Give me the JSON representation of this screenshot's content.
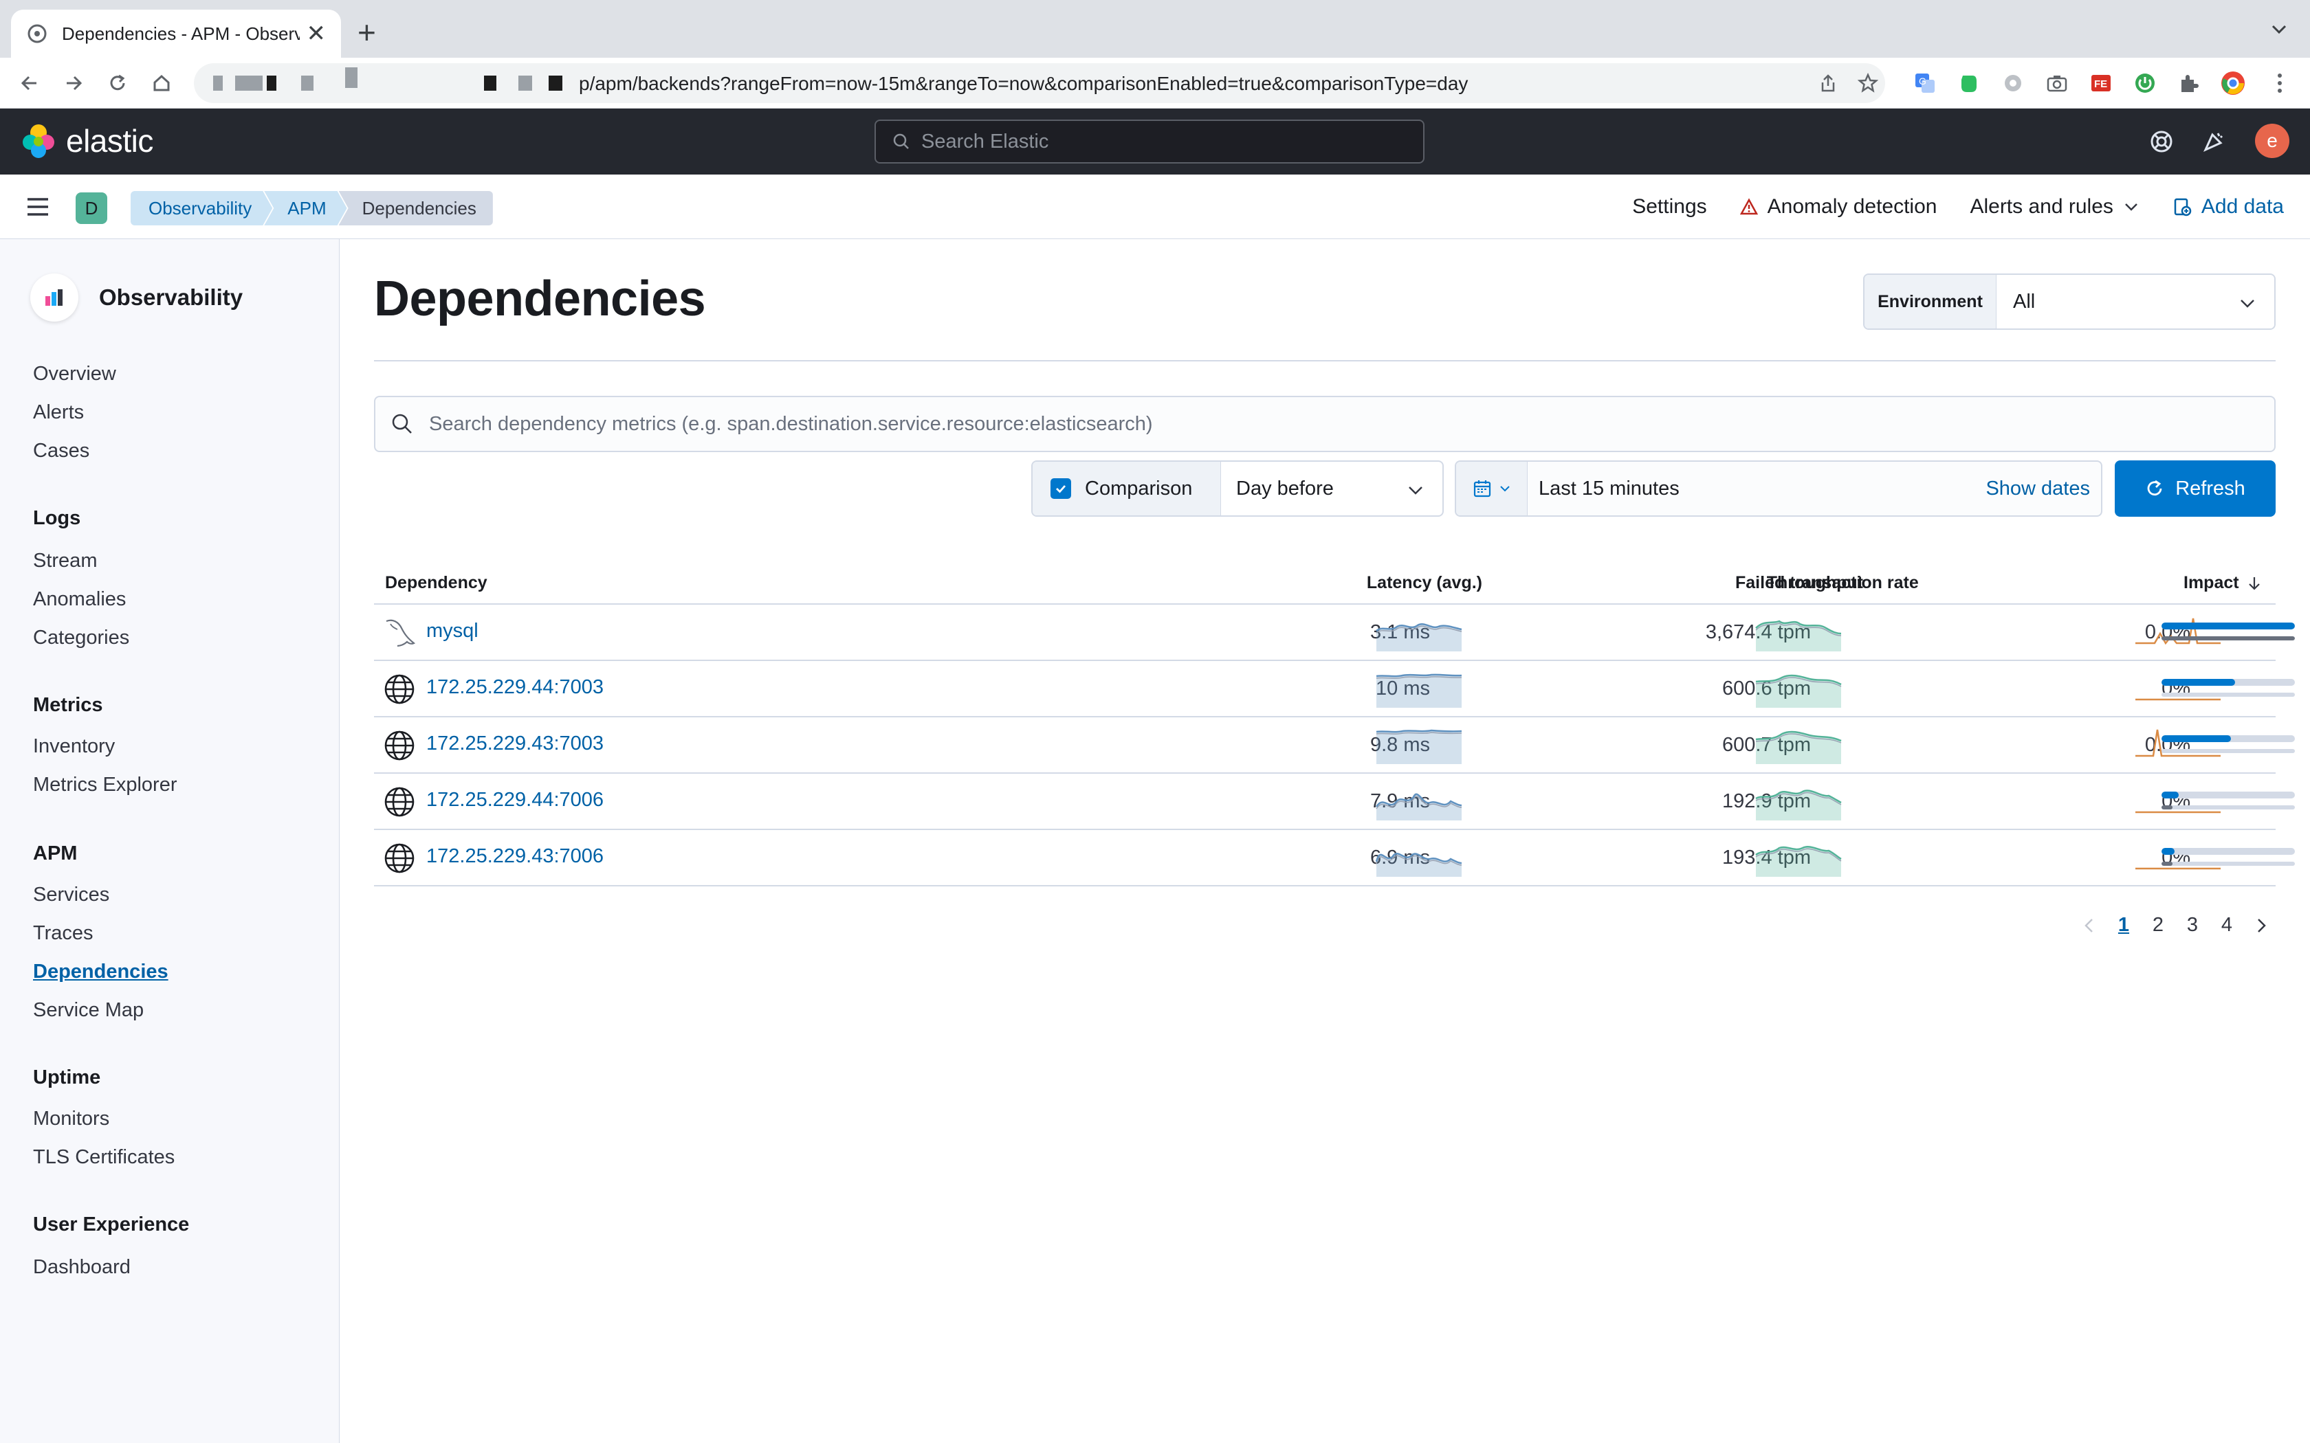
{
  "browser": {
    "tab_title": "Dependencies - APM - Observ",
    "url": "p/apm/backends?rangeFrom=now-15m&rangeTo=now&comparisonEnabled=true&comparisonType=day"
  },
  "header": {
    "logo_text": "elastic",
    "search_placeholder": "Search Elastic",
    "avatar_letter": "e"
  },
  "bar": {
    "space_letter": "D",
    "breadcrumbs": [
      "Observability",
      "APM",
      "Dependencies"
    ],
    "settings": "Settings",
    "anomaly": "Anomaly detection",
    "alerts": "Alerts and rules",
    "add_data": "Add data"
  },
  "sidenav": {
    "title": "Observability",
    "items": {
      "overview": "Overview",
      "alerts": "Alerts",
      "cases": "Cases",
      "logs": "Logs",
      "stream": "Stream",
      "anomalies": "Anomalies",
      "categories": "Categories",
      "metrics": "Metrics",
      "inventory": "Inventory",
      "metrics_explorer": "Metrics Explorer",
      "apm": "APM",
      "services": "Services",
      "traces": "Traces",
      "dependencies": "Dependencies",
      "service_map": "Service Map",
      "uptime": "Uptime",
      "monitors": "Monitors",
      "tls": "TLS Certificates",
      "ux": "User Experience",
      "dashboard": "Dashboard"
    }
  },
  "main": {
    "title": "Dependencies",
    "env_label": "Environment",
    "env_value": "All",
    "search_placeholder": "Search dependency metrics (e.g. span.destination.service.resource:elasticsearch)",
    "comparison_label": "Comparison",
    "comparison_value": "Day before",
    "range_label": "Last 15 minutes",
    "show_dates": "Show dates",
    "refresh": "Refresh",
    "columns": {
      "dependency": "Dependency",
      "latency": "Latency (avg.)",
      "throughput": "Throughput",
      "failed": "Failed transaction rate",
      "impact": "Impact"
    },
    "rows": [
      {
        "name": "mysql",
        "icon": "mysql-icon",
        "latency": "3.1 ms",
        "throughput": "3,674.4 tpm",
        "failed": "0.0%",
        "impact": 1.0,
        "impact_prev": 1.0
      },
      {
        "name": "172.25.229.44:7003",
        "icon": "globe-icon",
        "latency": "10 ms",
        "throughput": "600.6 tpm",
        "failed": "0%",
        "impact": 0.55,
        "impact_prev": 0.0
      },
      {
        "name": "172.25.229.43:7003",
        "icon": "globe-icon",
        "latency": "9.8 ms",
        "throughput": "600.7 tpm",
        "failed": "0.0%",
        "impact": 0.52,
        "impact_prev": 0.0
      },
      {
        "name": "172.25.229.44:7006",
        "icon": "globe-icon",
        "latency": "7.9 ms",
        "throughput": "192.9 tpm",
        "failed": "0%",
        "impact": 0.13,
        "impact_prev": 0.08
      },
      {
        "name": "172.25.229.43:7006",
        "icon": "globe-icon",
        "latency": "6.9 ms",
        "throughput": "193.4 tpm",
        "failed": "0%",
        "impact": 0.1,
        "impact_prev": 0.08
      }
    ],
    "pages": [
      "1",
      "2",
      "3",
      "4"
    ],
    "colors": {
      "latency": "#6092c0",
      "throughput": "#54b399",
      "failed": "#da8b45",
      "link": "#0061a6",
      "primary": "#0077cc"
    }
  }
}
